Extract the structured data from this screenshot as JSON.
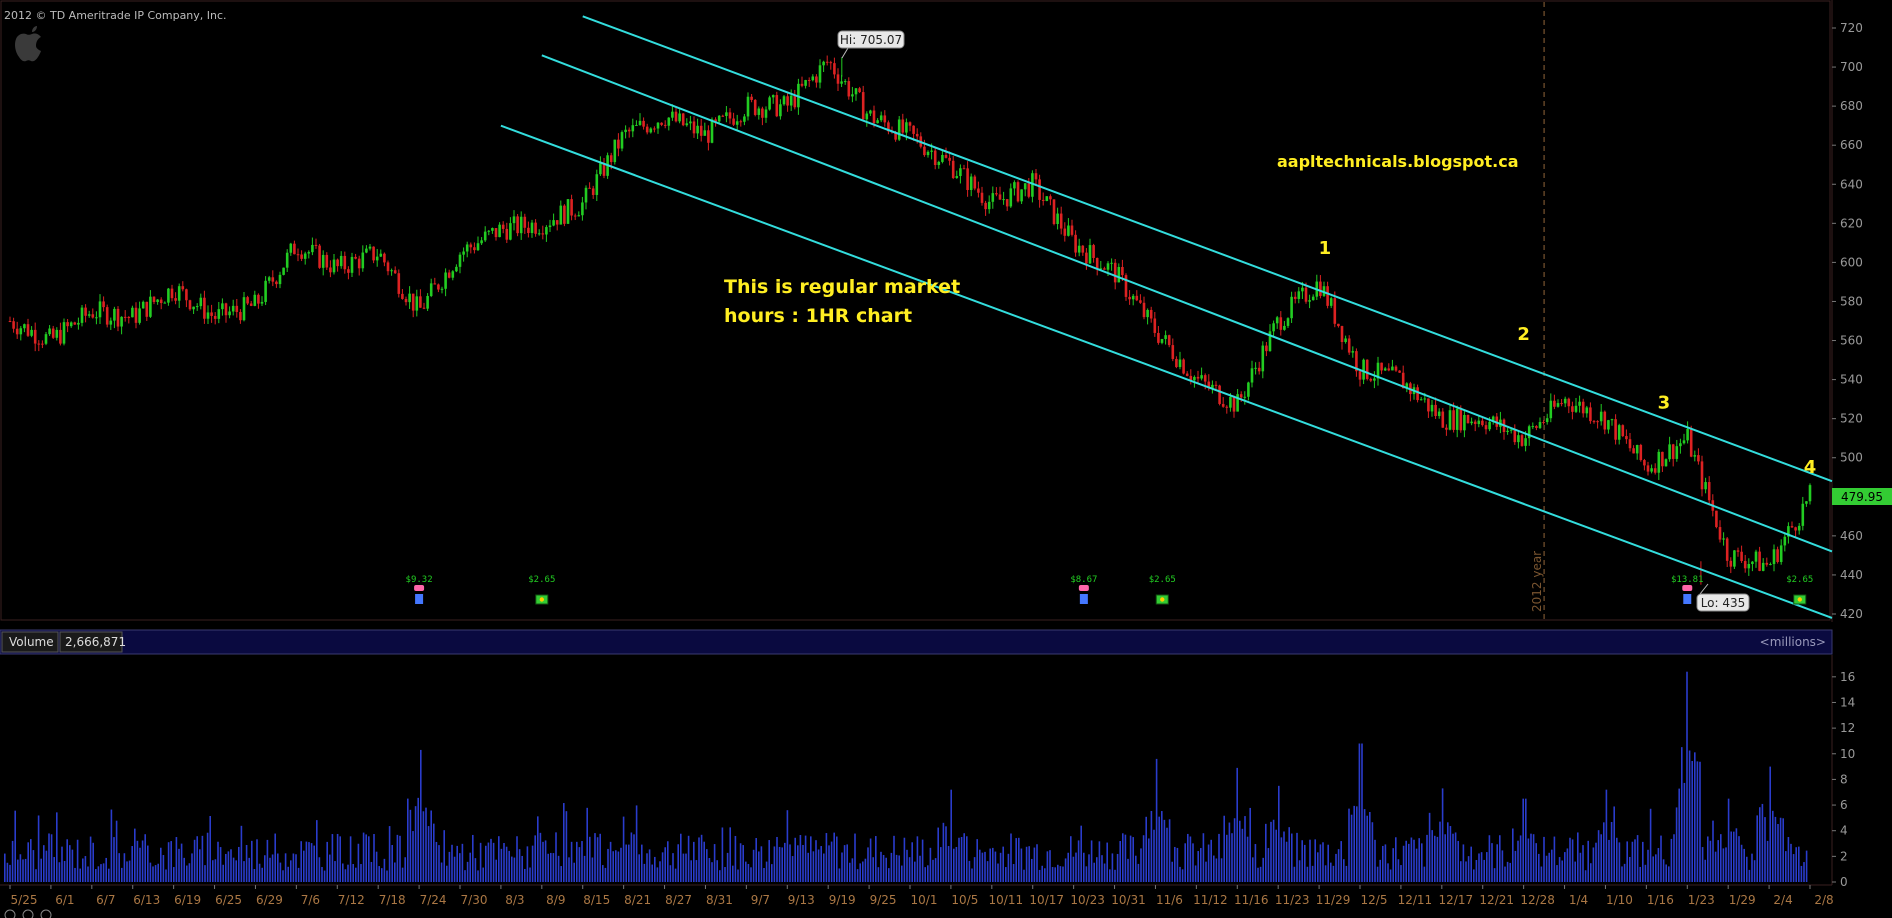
{
  "header": {
    "copyright": "2012 © TD Ameritrade IP Company, Inc.",
    "logo_icon": "apple-logo-icon"
  },
  "annotations": {
    "watermark": "aapltechnicals.blogspot.ca",
    "note_line1": "This is regular market",
    "note_line2": "hours : 1HR chart",
    "wave1": "1",
    "wave2": "2",
    "wave3": "3",
    "wave4": "4",
    "hi_label": "Hi: 705.07",
    "lo_label": "Lo: 435",
    "current_price": "479.95",
    "year_marker": "2012 year"
  },
  "events": [
    {
      "type": "earnings",
      "text": "$9.32",
      "icon": "earnings-phone-icon",
      "date": "7/24"
    },
    {
      "type": "dividend",
      "text": "$2.65",
      "icon": "dividend-icon",
      "date": "8/9"
    },
    {
      "type": "earnings",
      "text": "$8.67",
      "icon": "earnings-phone-icon",
      "date": "10/25"
    },
    {
      "type": "dividend",
      "text": "$2.65",
      "icon": "dividend-icon",
      "date": "11/7"
    },
    {
      "type": "earnings",
      "text": "$13.81",
      "icon": "earnings-phone-icon",
      "date": "1/23"
    },
    {
      "type": "dividend",
      "text": "$2.65",
      "icon": "dividend-icon",
      "date": "2/7"
    }
  ],
  "volume_header": {
    "label": "Volume",
    "value": "2,666,871",
    "unit": "<millions>"
  },
  "colors": {
    "background": "#000000",
    "up_candle": "#22cc22",
    "down_candle": "#dd2222",
    "channel": "#33dddd",
    "volume_bar": "#2a3ccc",
    "annotation": "#ffee22",
    "price_axis_text": "#999999",
    "current_price_bg": "#33cc33"
  },
  "chart_data": {
    "type": "candlestick",
    "symbol": "AAPL",
    "interval": "1 hour",
    "price_axis": {
      "ylim": [
        410,
        726
      ],
      "ticks": [
        420,
        440,
        460,
        480,
        500,
        520,
        540,
        560,
        580,
        600,
        620,
        640,
        660,
        680,
        700,
        720
      ]
    },
    "x_labels": [
      "5/25",
      "6/1",
      "6/7",
      "6/13",
      "6/19",
      "6/25",
      "6/29",
      "7/6",
      "7/12",
      "7/18",
      "7/24",
      "7/30",
      "8/3",
      "8/9",
      "8/15",
      "8/21",
      "8/27",
      "8/31",
      "9/7",
      "9/13",
      "9/19",
      "9/25",
      "10/1",
      "10/5",
      "10/11",
      "10/17",
      "10/23",
      "10/31",
      "11/6",
      "11/12",
      "11/16",
      "11/23",
      "11/29",
      "12/5",
      "12/11",
      "12/17",
      "12/21",
      "12/28",
      "1/4",
      "1/10",
      "1/16",
      "1/23",
      "1/29",
      "2/4",
      "2/8"
    ],
    "price_path": [
      {
        "date": "5/25",
        "price": 570
      },
      {
        "date": "6/1",
        "price": 560
      },
      {
        "date": "6/7",
        "price": 575
      },
      {
        "date": "6/13",
        "price": 572
      },
      {
        "date": "6/19",
        "price": 587
      },
      {
        "date": "6/25",
        "price": 572
      },
      {
        "date": "6/29",
        "price": 578
      },
      {
        "date": "7/6",
        "price": 609
      },
      {
        "date": "7/12",
        "price": 597
      },
      {
        "date": "7/18",
        "price": 605
      },
      {
        "date": "7/24",
        "price": 575
      },
      {
        "date": "7/30",
        "price": 605
      },
      {
        "date": "8/3",
        "price": 617
      },
      {
        "date": "8/9",
        "price": 620
      },
      {
        "date": "8/15",
        "price": 630
      },
      {
        "date": "8/21",
        "price": 665
      },
      {
        "date": "8/27",
        "price": 675
      },
      {
        "date": "8/31",
        "price": 665
      },
      {
        "date": "9/7",
        "price": 680
      },
      {
        "date": "9/13",
        "price": 680
      },
      {
        "date": "9/19",
        "price": 703
      },
      {
        "date": "9/25",
        "price": 675
      },
      {
        "date": "10/1",
        "price": 665
      },
      {
        "date": "10/5",
        "price": 650
      },
      {
        "date": "10/11",
        "price": 630
      },
      {
        "date": "10/17",
        "price": 640
      },
      {
        "date": "10/23",
        "price": 610
      },
      {
        "date": "10/31",
        "price": 595
      },
      {
        "date": "11/6",
        "price": 565
      },
      {
        "date": "11/12",
        "price": 540
      },
      {
        "date": "11/16",
        "price": 527
      },
      {
        "date": "11/23",
        "price": 570
      },
      {
        "date": "11/29",
        "price": 590
      },
      {
        "date": "12/5",
        "price": 545
      },
      {
        "date": "12/11",
        "price": 540
      },
      {
        "date": "12/17",
        "price": 520
      },
      {
        "date": "12/21",
        "price": 520
      },
      {
        "date": "12/28",
        "price": 510
      },
      {
        "date": "1/4",
        "price": 530
      },
      {
        "date": "1/10",
        "price": 520
      },
      {
        "date": "1/16",
        "price": 495
      },
      {
        "date": "1/23",
        "price": 510
      },
      {
        "date": "1/29",
        "price": 450
      },
      {
        "date": "2/4",
        "price": 445
      },
      {
        "date": "2/8",
        "price": 480
      }
    ],
    "high": {
      "value": 705.07,
      "date": "9/21"
    },
    "low": {
      "value": 435,
      "date": "1/25"
    },
    "last": 479.95,
    "channel_lines": [
      {
        "name": "upper",
        "start": {
          "date": "8/15",
          "price": 726
        },
        "end": {
          "date": "2/8",
          "price": 488
        }
      },
      {
        "name": "middle",
        "start": {
          "date": "8/9",
          "price": 706
        },
        "end": {
          "date": "2/8",
          "price": 452
        }
      },
      {
        "name": "lower",
        "start": {
          "date": "8/3",
          "price": 670
        },
        "end": {
          "date": "2/8",
          "price": 418
        }
      }
    ],
    "wave_points": [
      {
        "label": "1",
        "date": "11/30",
        "price": 596
      },
      {
        "label": "2",
        "date": "12/28",
        "price": 552
      },
      {
        "label": "3",
        "date": "1/19",
        "price": 517
      },
      {
        "label": "4",
        "date": "2/8",
        "price": 484
      }
    ],
    "volume": {
      "unit": "millions",
      "ylim": [
        0,
        17
      ],
      "ticks": [
        0,
        2,
        4,
        6,
        8,
        10,
        12,
        14,
        16
      ],
      "typical": 2.5,
      "spikes": [
        {
          "date": "7/24",
          "value": 10.3
        },
        {
          "date": "8/21",
          "value": 5.1
        },
        {
          "date": "9/13",
          "value": 5.6
        },
        {
          "date": "10/5",
          "value": 7.2
        },
        {
          "date": "11/6",
          "value": 9.6
        },
        {
          "date": "11/16",
          "value": 8.9
        },
        {
          "date": "11/23",
          "value": 7.5
        },
        {
          "date": "12/5",
          "value": 10.8
        },
        {
          "date": "12/17",
          "value": 7.3
        },
        {
          "date": "12/28",
          "value": 6.5
        },
        {
          "date": "1/10",
          "value": 7.2
        },
        {
          "date": "1/23",
          "value": 16.4
        },
        {
          "date": "1/29",
          "value": 6.5
        },
        {
          "date": "2/4",
          "value": 9.0
        }
      ]
    }
  }
}
